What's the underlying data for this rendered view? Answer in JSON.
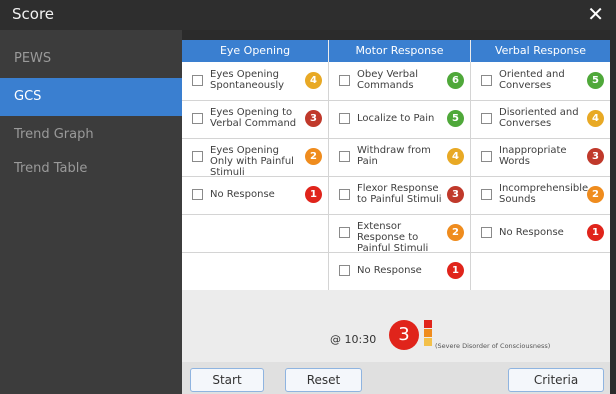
{
  "window": {
    "title": "Score",
    "close_icon": "close-icon"
  },
  "sidebar": {
    "items": [
      {
        "label": "PEWS"
      },
      {
        "label": "GCS"
      },
      {
        "label": "Trend Graph"
      },
      {
        "label": "Trend Table"
      }
    ],
    "active": "GCS"
  },
  "columns": [
    {
      "header": "Eye Opening"
    },
    {
      "header": "Motor Response"
    },
    {
      "header": "Verbal Response"
    }
  ],
  "eye": [
    {
      "label": "Eyes Opening Spontaneously",
      "score": "4"
    },
    {
      "label": "Eyes Opening to Verbal Command",
      "score": "3"
    },
    {
      "label": "Eyes Opening Only with Painful Stimuli",
      "score": "2"
    },
    {
      "label": "No Response",
      "score": "1"
    }
  ],
  "motor": [
    {
      "label": "Obey Verbal Commands",
      "score": "6"
    },
    {
      "label": "Localize to Pain",
      "score": "5"
    },
    {
      "label": "Withdraw from Pain",
      "score": "4"
    },
    {
      "label": "Flexor Response to Painful Stimuli",
      "score": "3"
    },
    {
      "label": "Extensor Response to Painful Stimuli",
      "score": "2"
    },
    {
      "label": "No Response",
      "score": "1"
    }
  ],
  "verbal": [
    {
      "label": "Oriented and Converses",
      "score": "5"
    },
    {
      "label": "Disoriented and Converses",
      "score": "4"
    },
    {
      "label": "Inappropriate Words",
      "score": "3"
    },
    {
      "label": "Incomprehensible Sounds",
      "score": "2"
    },
    {
      "label": "No Response",
      "score": "1"
    }
  ],
  "score_colors": {
    "6": "#4fa83a",
    "5": "#4fa83a",
    "4": "#e8a925",
    "3": "#c0392b",
    "2": "#ef8c1e",
    "1": "#e0241b"
  },
  "summary": {
    "time": "@ 10:30",
    "total": "3",
    "description": "(Severe Disorder of Consciousness)",
    "severity_bar": [
      "#e0241b",
      "#ef8c1e",
      "#f3c04a"
    ]
  },
  "buttons": {
    "start": "Start",
    "reset": "Reset",
    "criteria": "Criteria"
  },
  "accent_color": "#3a7fd0"
}
